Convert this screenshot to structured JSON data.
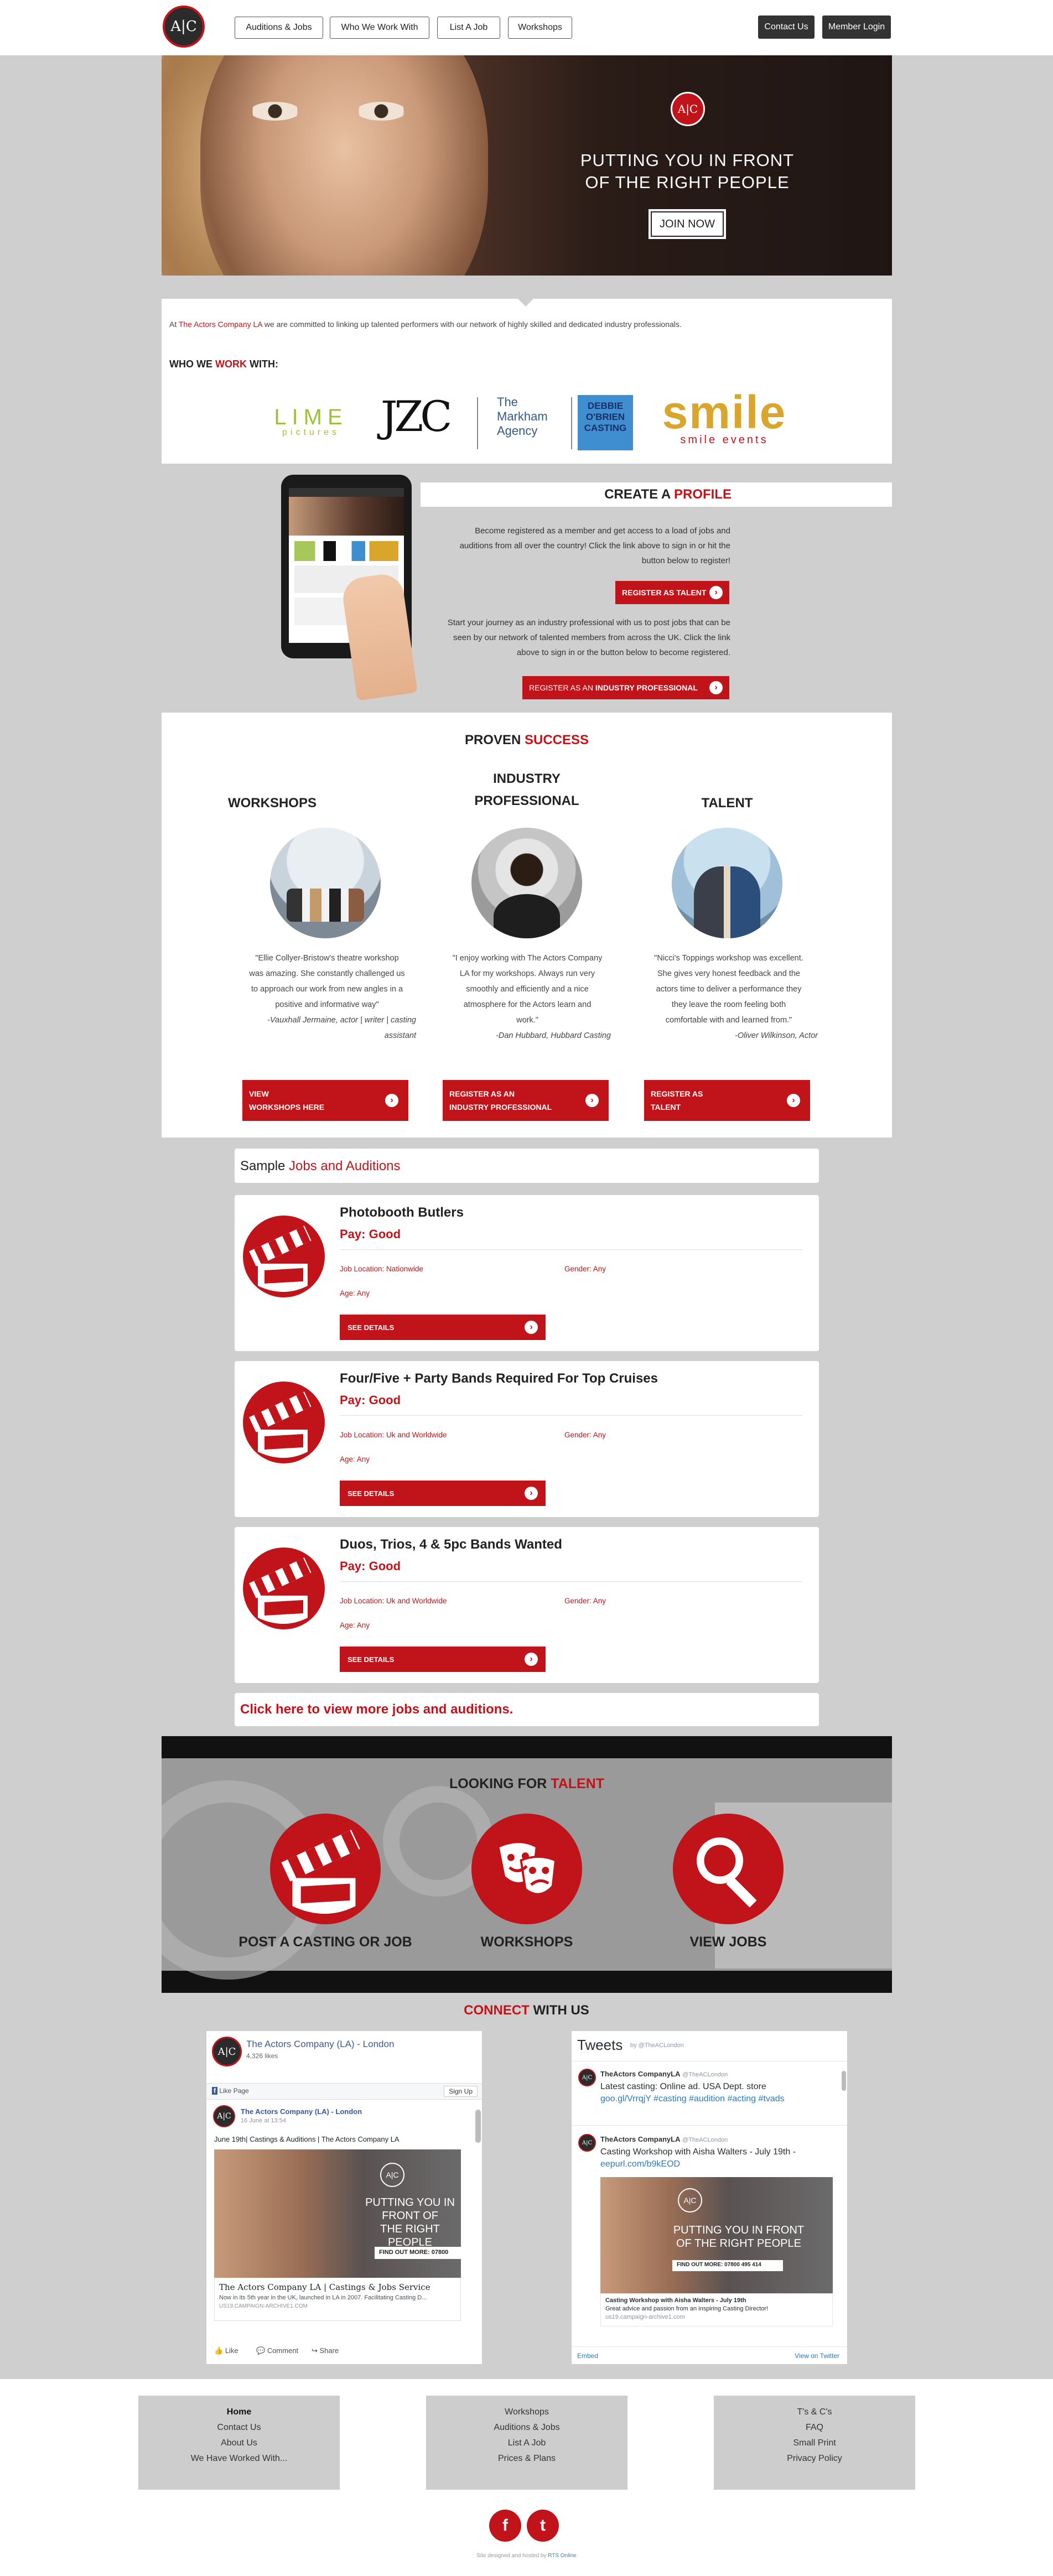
{
  "header": {
    "logo": "A|C",
    "nav": [
      "Auditions & Jobs",
      "Who We Work With",
      "List A Job",
      "Workshops"
    ],
    "contact": "Contact Us",
    "login": "Member Login"
  },
  "hero": {
    "logo": "A|C",
    "tagline_1": "PUTTING YOU IN FRONT",
    "tagline_2": "OF THE RIGHT PEOPLE",
    "join": "JOIN NOW"
  },
  "intro": {
    "pre": "At ",
    "company": "The Actors Company LA",
    "post": " we are committed to linking up talented performers with our network of highly skilled and dedicated industry professionals.",
    "who_a": "WHO WE ",
    "who_b": "WORK",
    "who_c": " WITH:",
    "partners": {
      "lime": "LIME",
      "lime_sub": "pictures",
      "jzc": "JZC",
      "markham_1": "The",
      "markham_2": "Markham",
      "markham_3": "Agency",
      "debbie_1": "DEBBIE",
      "debbie_2": "O'BRIEN",
      "debbie_3": "CASTING",
      "smile": "smile",
      "smile_sub": "smile events"
    }
  },
  "profile": {
    "title_a": "CREATE A ",
    "title_b": "PROFILE",
    "talent_text_1": "Become registered as a member and get access to a load of jobs and",
    "talent_text_2": "auditions from all over the country! Click the link above to sign in or hit the",
    "talent_text_3": "button below to register!",
    "talent_btn": "REGISTER AS TALENT",
    "pro_text_1": "Start your journey as an industry professional with us to post jobs that can be",
    "pro_text_2": "seen by our network of talented members from across the UK. Click the link",
    "pro_text_3": "above to sign in or the button below to become registered.",
    "pro_btn_a": "REGISTER AS AN ",
    "pro_btn_b": "INDUSTRY PROFESSIONAL"
  },
  "proven": {
    "title_a": "PROVEN ",
    "title_b": "SUCCESS",
    "cols": [
      {
        "title": "WORKSHOPS",
        "quote_1": "\"Ellie Collyer-Bristow's theatre workshop",
        "quote_2": "was amazing. She constantly challenged us",
        "quote_3": "to approach our work from new angles in a",
        "quote_4": "positive and informative way\"",
        "by_1": "-Vauxhall Jermaine, actor | writer | casting",
        "by_2": "assistant",
        "btn_1": "VIEW",
        "btn_2": "WORKSHOPS HERE"
      },
      {
        "title_1": "INDUSTRY",
        "title_2": "PROFESSIONAL",
        "quote_1": "\"I enjoy working with The Actors Company",
        "quote_2": "LA for my workshops. Always run very",
        "quote_3": "smoothly and efficiently and a nice",
        "quote_4": "atmosphere for the Actors learn and",
        "quote_5": "work.\"",
        "by_1": "-Dan Hubbard, Hubbard Casting",
        "btn_1": "REGISTER AS AN",
        "btn_2": "INDUSTRY PROFESSIONAL"
      },
      {
        "title": "TALENT",
        "quote_1": "\"Nicci's Toppings workshop was excellent.",
        "quote_2": "She gives very honest feedback and the",
        "quote_3": "actors time to deliver a performance they",
        "quote_4": "they leave the room feeling both",
        "quote_5": "comfortable with and learned from.\"",
        "by_1": "-Oliver Wilkinson, Actor",
        "btn_1": "REGISTER AS",
        "btn_2": "TALENT"
      }
    ]
  },
  "jobs": {
    "heading_a": "Sample ",
    "heading_b": "Jobs and Auditions",
    "items": [
      {
        "title": "Photobooth Butlers",
        "pay": "Pay: Good",
        "location": "Job Location: Nationwide",
        "gender": "Gender: Any",
        "age": "Age: Any",
        "btn": "SEE DETAILS"
      },
      {
        "title": "Four/Five + Party Bands Required For Top Cruises",
        "pay": "Pay: Good",
        "location": "Job Location: Uk and Worldwide",
        "gender": "Gender: Any",
        "age": "Age: Any",
        "btn": "SEE DETAILS"
      },
      {
        "title": "Duos, Trios, 4 & 5pc Bands Wanted",
        "pay": "Pay: Good",
        "location": "Job Location: Uk and Worldwide",
        "gender": "Gender: Any",
        "age": "Age: Any",
        "btn": "SEE DETAILS"
      }
    ],
    "more": "Click here to view more jobs and auditions."
  },
  "talent": {
    "title_a": "LOOKING FOR ",
    "title_b": "TALENT",
    "items": [
      "POST A CASTING OR JOB",
      "WORKSHOPS",
      "VIEW JOBS"
    ]
  },
  "connect": {
    "title_a": "CONNECT",
    "title_b": " WITH US",
    "facebook": {
      "page_name": "The Actors Company (LA) - London",
      "likes": "4,326 likes",
      "like_btn": "Like Page",
      "signup_btn": "Sign Up",
      "post_author": "The Actors Company (LA) - London",
      "post_date": "16 June at 13:54",
      "post_text": "June 19th| Castings & Auditions | The Actors Company LA",
      "img_text_1": "PUTTING YOU IN",
      "img_text_2": "FRONT OF",
      "img_text_3": "THE RIGHT PEOPLE",
      "img_cta": "FIND OUT MORE: 07800",
      "link_title": "The Actors Company LA | Castings & Jobs Service",
      "link_desc": "Now in its 5th year in the UK, launched in LA in 2007. Facilitating Casting D...",
      "link_url": "US19.CAMPAIGN-ARCHIVE1.COM",
      "actions": [
        "Like",
        "Comment",
        "Share"
      ]
    },
    "twitter": {
      "title": "Tweets",
      "by": "by @TheACLondon",
      "tweets": [
        {
          "name": "TheActors CompanyLA",
          "handle": "@TheACLondon",
          "text_1": "Latest casting: Online ad. USA Dept. store",
          "text_2": "goo.gl/VrrqjY #casting #audition #acting #tvads"
        },
        {
          "name": "TheActors CompanyLA",
          "handle": "@TheACLondon",
          "text_1": "Casting Workshop with Aisha Walters - July 19th -",
          "text_2": "eepurl.com/b9kEOD"
        }
      ],
      "img_text_1": "PUTTING YOU IN FRONT",
      "img_text_2": "OF THE RIGHT PEOPLE",
      "img_cta": "FIND OUT MORE: 07800 495 414",
      "card_title": "Casting Workshop with Aisha Walters - July 19th",
      "card_desc": "Great advice and passion from an inspiring Casting Director!",
      "card_url": "us19.campaign-archive1.com",
      "embed": "Embed",
      "view": "View on Twitter"
    }
  },
  "footer": {
    "col1": [
      "Home",
      "Contact Us",
      "About Us",
      "We Have Worked With..."
    ],
    "col2": [
      "Workshops",
      "Auditions & Jobs",
      "List A Job",
      "Prices & Plans"
    ],
    "col3": [
      "T's & C's",
      "FAQ",
      "Small Print",
      "Privacy Policy"
    ],
    "facebook": "f",
    "twitter": "t",
    "credit_a": "Site designed and hosted by ",
    "credit_b": "RTS Online"
  },
  "colors": {
    "accent": "#c0141a",
    "background": "#cfcfcf",
    "dark": "#333333"
  }
}
